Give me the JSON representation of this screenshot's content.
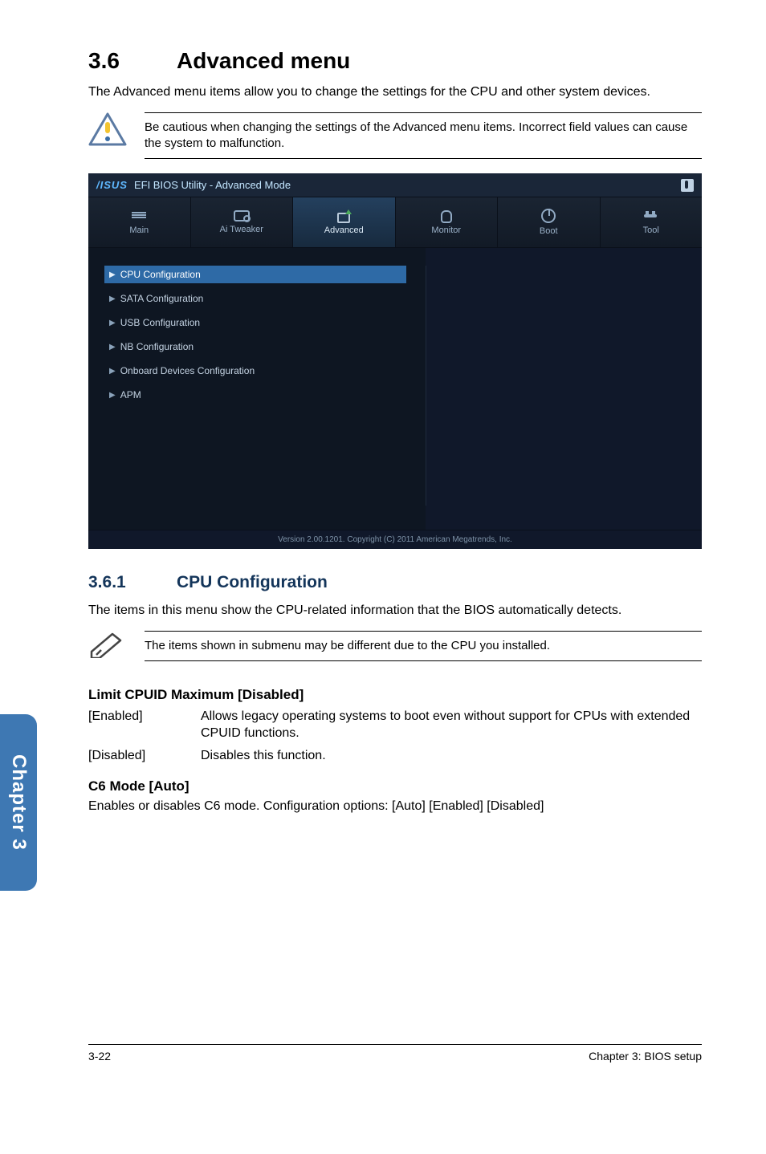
{
  "side_tab": "Chapter 3",
  "section": {
    "number": "3.6",
    "title": "Advanced menu"
  },
  "intro": "The Advanced menu items allow you to change the settings for the CPU and other system devices.",
  "warning": "Be cautious when changing the settings of the Advanced menu items. Incorrect field values can cause the system to malfunction.",
  "bios": {
    "logo_brand": "/ISUS",
    "logo_title": "EFI BIOS Utility - Advanced Mode",
    "tabs": [
      "Main",
      "Ai  Tweaker",
      "Advanced",
      "Monitor",
      "Boot",
      "Tool"
    ],
    "active_tab_index": 2,
    "items": [
      "CPU Configuration",
      "SATA Configuration",
      "USB Configuration",
      "NB Configuration",
      "Onboard Devices Configuration",
      "APM"
    ],
    "selected_item_index": 0,
    "footer": "Version  2.00.1201.   Copyright  (C)  2011  American  Megatrends,  Inc."
  },
  "subsection": {
    "number": "3.6.1",
    "title": "CPU Configuration"
  },
  "subsection_intro": "The items in this menu show the CPU-related information that the BIOS automatically detects.",
  "note": "The items shown in submenu may be different due to the CPU you installed.",
  "limit_heading": "Limit CPUID Maximum [Disabled]",
  "limit_rows": [
    {
      "term": "[Enabled]",
      "desc": "Allows legacy operating systems to boot even without support for CPUs with extended CPUID functions."
    },
    {
      "term": "[Disabled]",
      "desc": "Disables this function."
    }
  ],
  "c6_heading": "C6 Mode [Auto]",
  "c6_body": "Enables or disables C6 mode. Configuration options: [Auto] [Enabled] [Disabled]",
  "footer": {
    "left": "3-22",
    "right": "Chapter 3: BIOS setup"
  }
}
